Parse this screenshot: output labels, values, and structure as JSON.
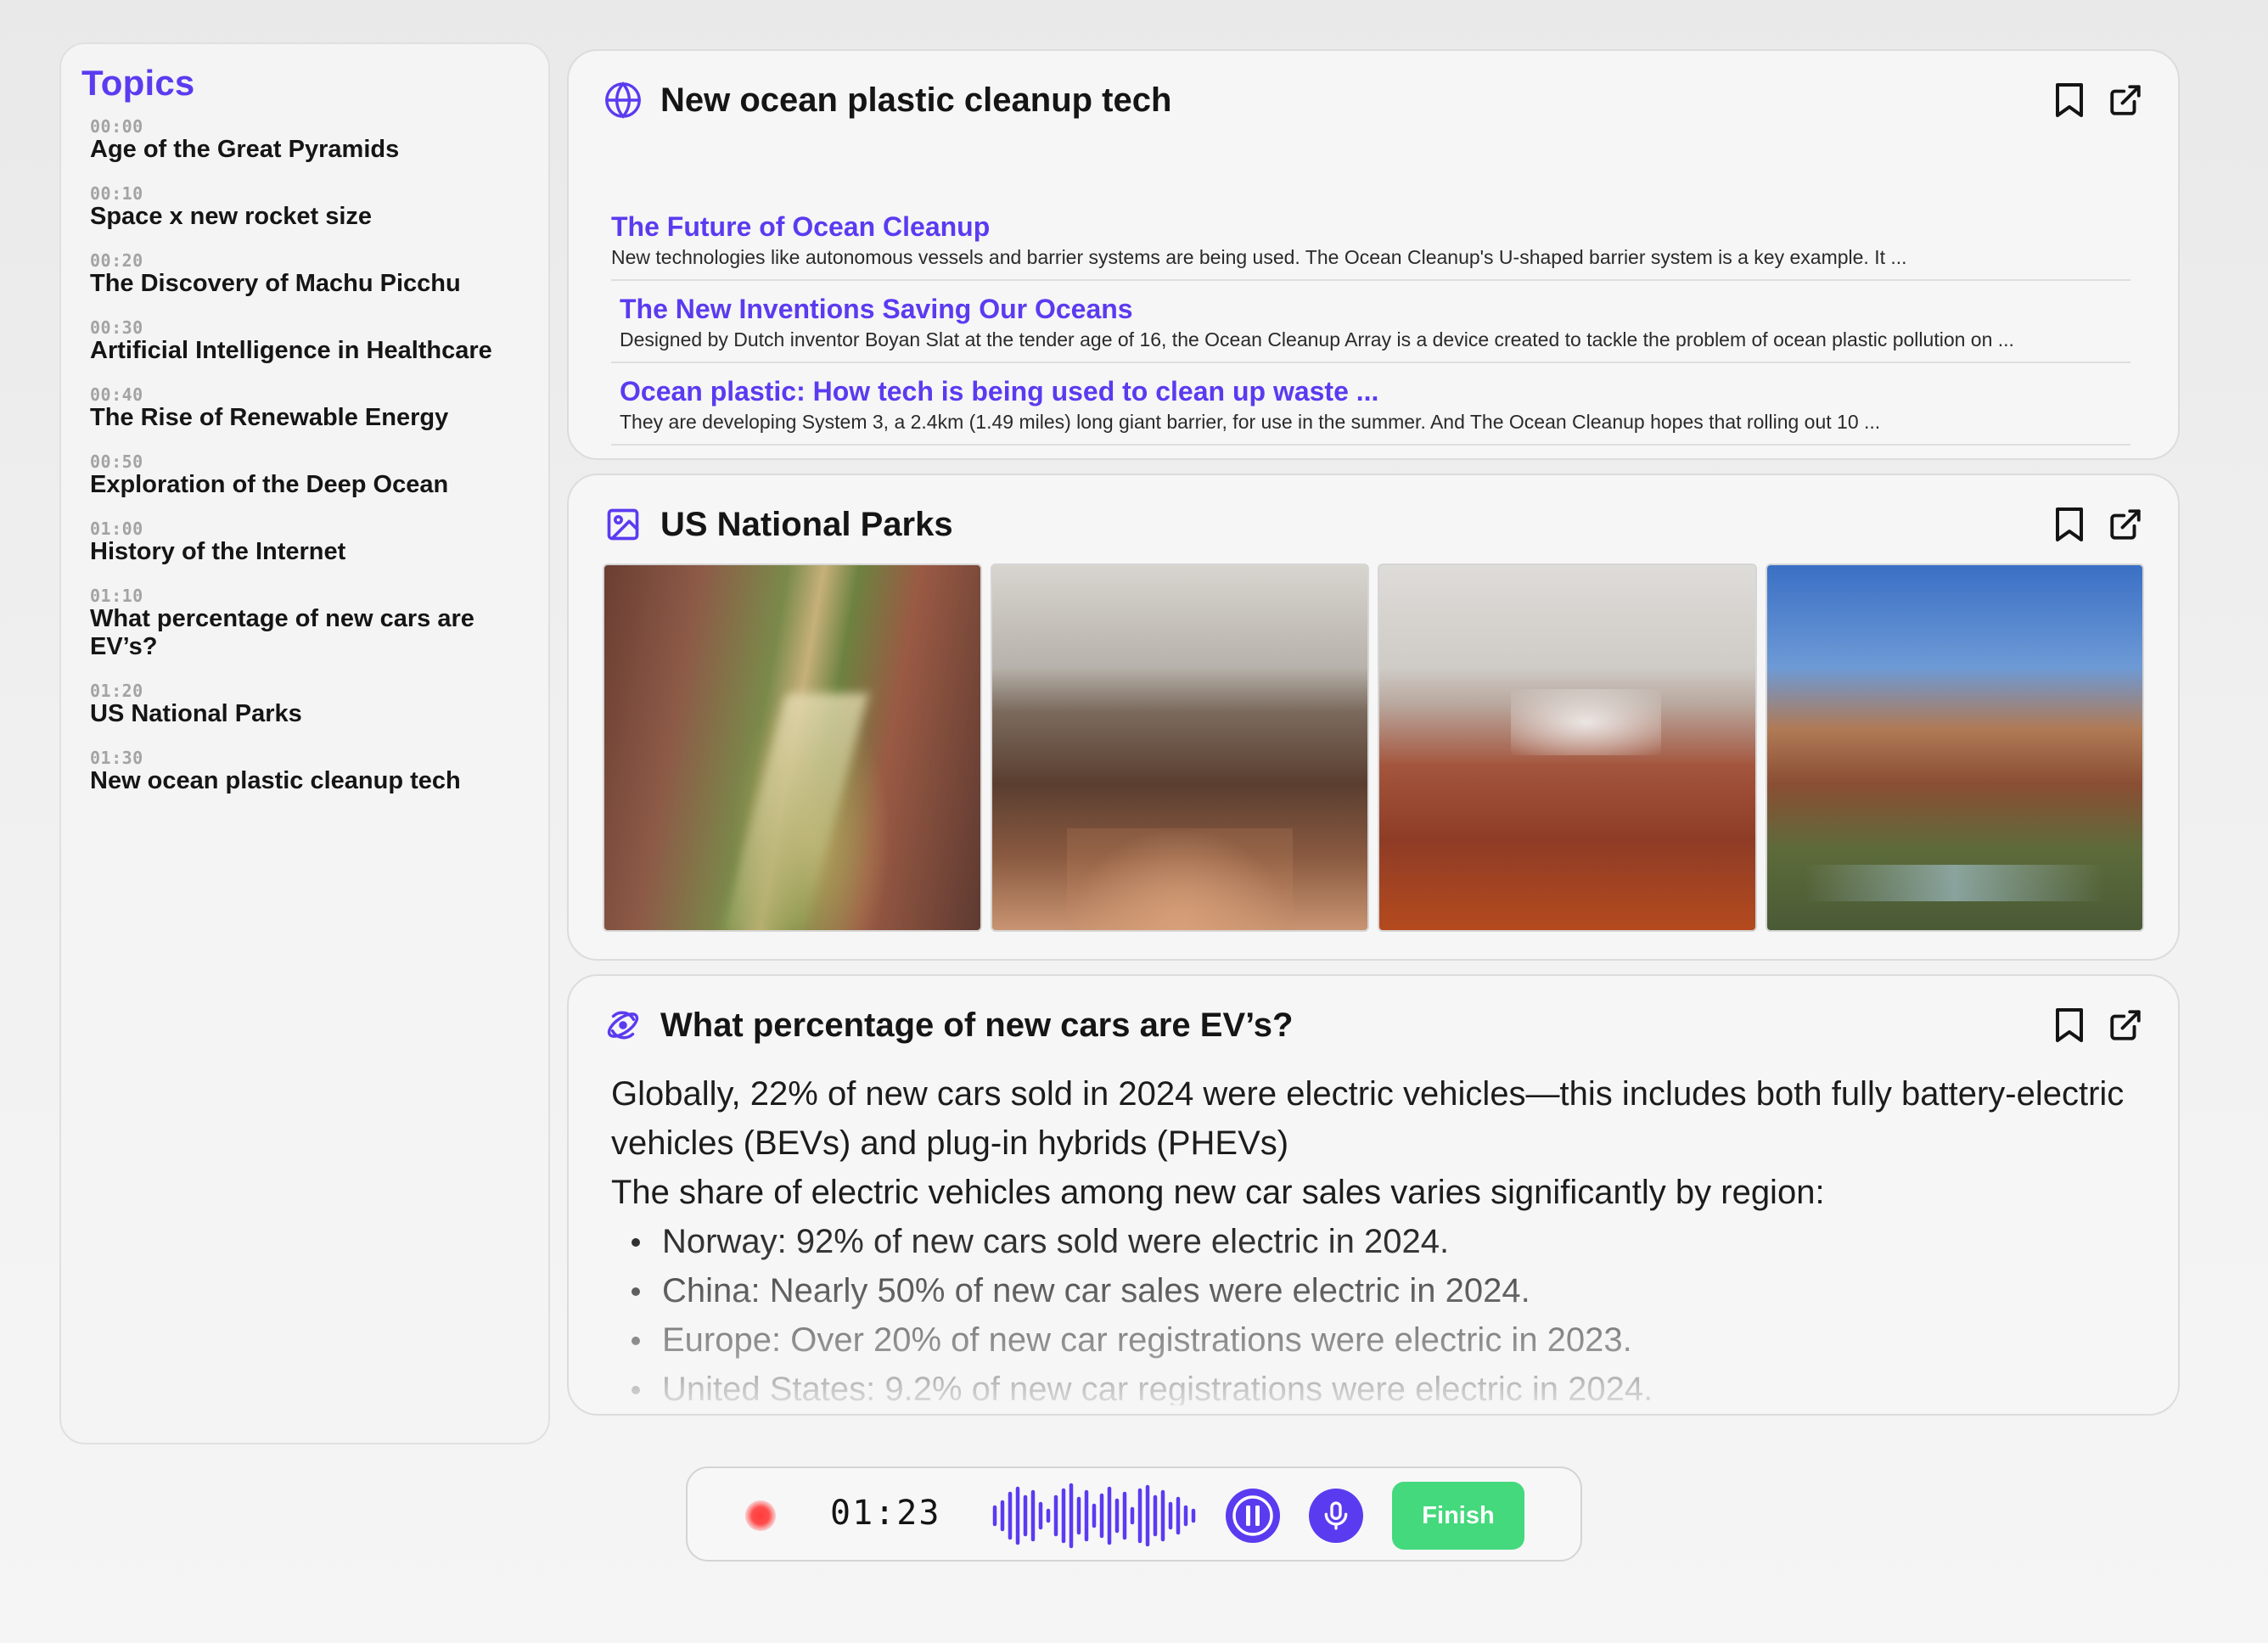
{
  "sidebar": {
    "title": "Topics",
    "topics": [
      {
        "time": "00:00",
        "title": "Age of the Great Pyramids"
      },
      {
        "time": "00:10",
        "title": "Space x new rocket size"
      },
      {
        "time": "00:20",
        "title": "The Discovery of Machu Picchu"
      },
      {
        "time": "00:30",
        "title": "Artificial Intelligence in Healthcare"
      },
      {
        "time": "00:40",
        "title": "The Rise of Renewable Energy"
      },
      {
        "time": "00:50",
        "title": "Exploration of the Deep Ocean"
      },
      {
        "time": "01:00",
        "title": "History of the Internet"
      },
      {
        "time": "01:10",
        "title": "What percentage of new cars are EV’s?"
      },
      {
        "time": "01:20",
        "title": "US National Parks"
      },
      {
        "time": "01:30",
        "title": "New ocean plastic cleanup tech"
      }
    ]
  },
  "web_card": {
    "icon": "globe-icon",
    "title": "New ocean plastic cleanup tech",
    "results": [
      {
        "title": "The Future of Ocean Cleanup",
        "snippet": "New technologies like autonomous vessels and barrier systems are being used. The Ocean Cleanup's U-shaped barrier system is a key example. It ..."
      },
      {
        "title": "The New Inventions Saving Our Oceans",
        "snippet": "Designed by Dutch inventor Boyan Slat at the tender age of 16, the Ocean Cleanup Array is a device created to tackle the problem of ocean plastic pollution on ..."
      },
      {
        "title": "Ocean plastic: How tech is being used to clean up waste ...",
        "snippet": "They are developing System 3, a 2.4km (1.49 miles) long giant barrier, for use in the summer. And The Ocean Cleanup hopes that rolling out 10 ..."
      }
    ]
  },
  "image_card": {
    "icon": "image-icon",
    "title": "US National Parks",
    "images": [
      "canyon-river-aerial",
      "canyon-overlook-cloudy",
      "red-cliffs-snow-fog",
      "canyon-blue-sky-river"
    ]
  },
  "answer_card": {
    "icon": "ai-orbit-icon",
    "title": "What percentage of new cars are EV’s?",
    "paragraphs": [
      "Globally, 22% of new cars sold in 2024 were electric vehicles—this includes both fully battery-electric vehicles (BEVs) and plug-in hybrids (PHEVs)",
      "The share of electric vehicles among new car sales varies significantly by region:"
    ],
    "bullets": [
      "Norway: 92% of new cars sold were electric in 2024.",
      "China: Nearly 50% of new car sales were electric in 2024.",
      "Europe: Over 20% of new car registrations were electric in 2023.",
      "United States: 9.2% of new car registrations were electric in 2024."
    ]
  },
  "recorder": {
    "time": "01:23",
    "finish_label": "Finish",
    "accent_color": "#5b3bf0",
    "finish_color": "#44d97c",
    "record_color": "#ff3b3b"
  }
}
